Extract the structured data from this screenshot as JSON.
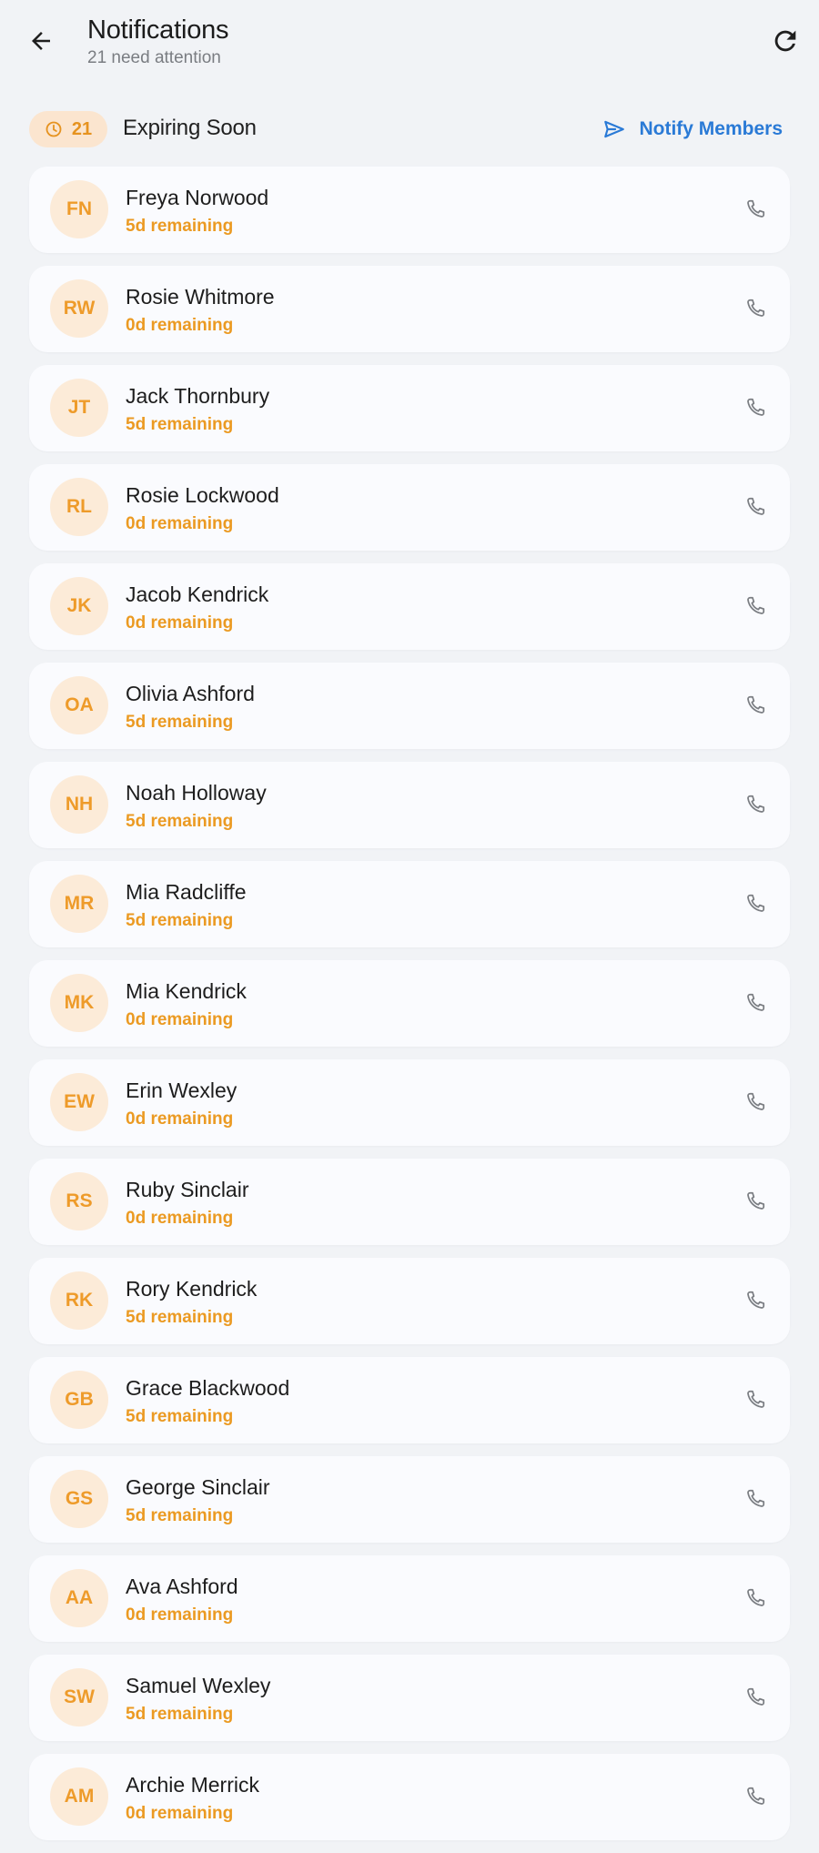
{
  "header": {
    "title": "Notifications",
    "subtitle": "21 need attention",
    "back_icon": "arrow-left-icon",
    "refresh_icon": "refresh-icon"
  },
  "section": {
    "badge_count": "21",
    "badge_icon": "clock-icon",
    "title": "Expiring Soon",
    "notify_label": "Notify Members",
    "notify_icon": "send-icon"
  },
  "colors": {
    "accent_orange": "#eb9a22",
    "avatar_bg": "#fcebd8",
    "link_blue": "#2a7ad6",
    "background": "#f1f3f6",
    "card_bg": "#fafbfe"
  },
  "members": [
    {
      "initials": "FN",
      "name": "Freya Norwood",
      "status": "5d remaining"
    },
    {
      "initials": "RW",
      "name": "Rosie Whitmore",
      "status": "0d remaining"
    },
    {
      "initials": "JT",
      "name": "Jack Thornbury",
      "status": "5d remaining"
    },
    {
      "initials": "RL",
      "name": "Rosie Lockwood",
      "status": "0d remaining"
    },
    {
      "initials": "JK",
      "name": "Jacob Kendrick",
      "status": "0d remaining"
    },
    {
      "initials": "OA",
      "name": "Olivia Ashford",
      "status": "5d remaining"
    },
    {
      "initials": "NH",
      "name": "Noah Holloway",
      "status": "5d remaining"
    },
    {
      "initials": "MR",
      "name": "Mia Radcliffe",
      "status": "5d remaining"
    },
    {
      "initials": "MK",
      "name": "Mia Kendrick",
      "status": "0d remaining"
    },
    {
      "initials": "EW",
      "name": "Erin Wexley",
      "status": "0d remaining"
    },
    {
      "initials": "RS",
      "name": "Ruby Sinclair",
      "status": "0d remaining"
    },
    {
      "initials": "RK",
      "name": "Rory Kendrick",
      "status": "5d remaining"
    },
    {
      "initials": "GB",
      "name": "Grace Blackwood",
      "status": "5d remaining"
    },
    {
      "initials": "GS",
      "name": "George Sinclair",
      "status": "5d remaining"
    },
    {
      "initials": "AA",
      "name": "Ava Ashford",
      "status": "0d remaining"
    },
    {
      "initials": "SW",
      "name": "Samuel Wexley",
      "status": "5d remaining"
    },
    {
      "initials": "AM",
      "name": "Archie Merrick",
      "status": "0d remaining"
    }
  ]
}
